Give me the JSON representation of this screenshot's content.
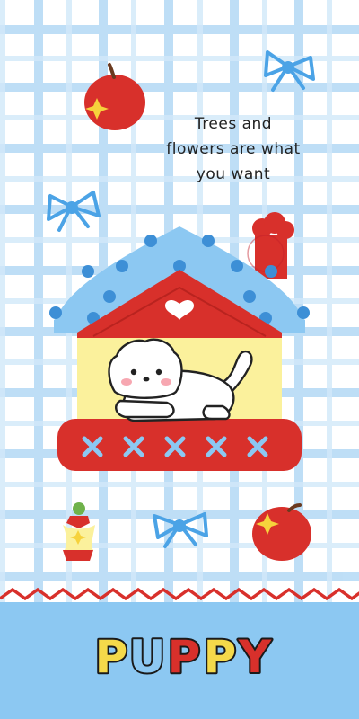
{
  "wallpaper": {
    "quote_lines": [
      "Trees and",
      "flowers are what",
      "you want"
    ],
    "title_letters": [
      "P",
      "U",
      "P",
      "P",
      "Y"
    ],
    "colors": {
      "grid": "#a9d4f4",
      "roof": "#8cc8f2",
      "roof_dots": "#3d8fd6",
      "red": "#d8302b",
      "house_wall": "#fbf19c",
      "bow": "#4ba3e6",
      "band": "#8cc8f2",
      "letter_colors": [
        "#f4d94a",
        "#8cc8f2",
        "#d8302b",
        "#f4d94a",
        "#d8302b"
      ]
    },
    "icons": [
      "apple-icon",
      "apple-core-icon",
      "bow-icon",
      "puppy-icon",
      "heart-icon",
      "house-icon",
      "stamp-seal"
    ]
  }
}
